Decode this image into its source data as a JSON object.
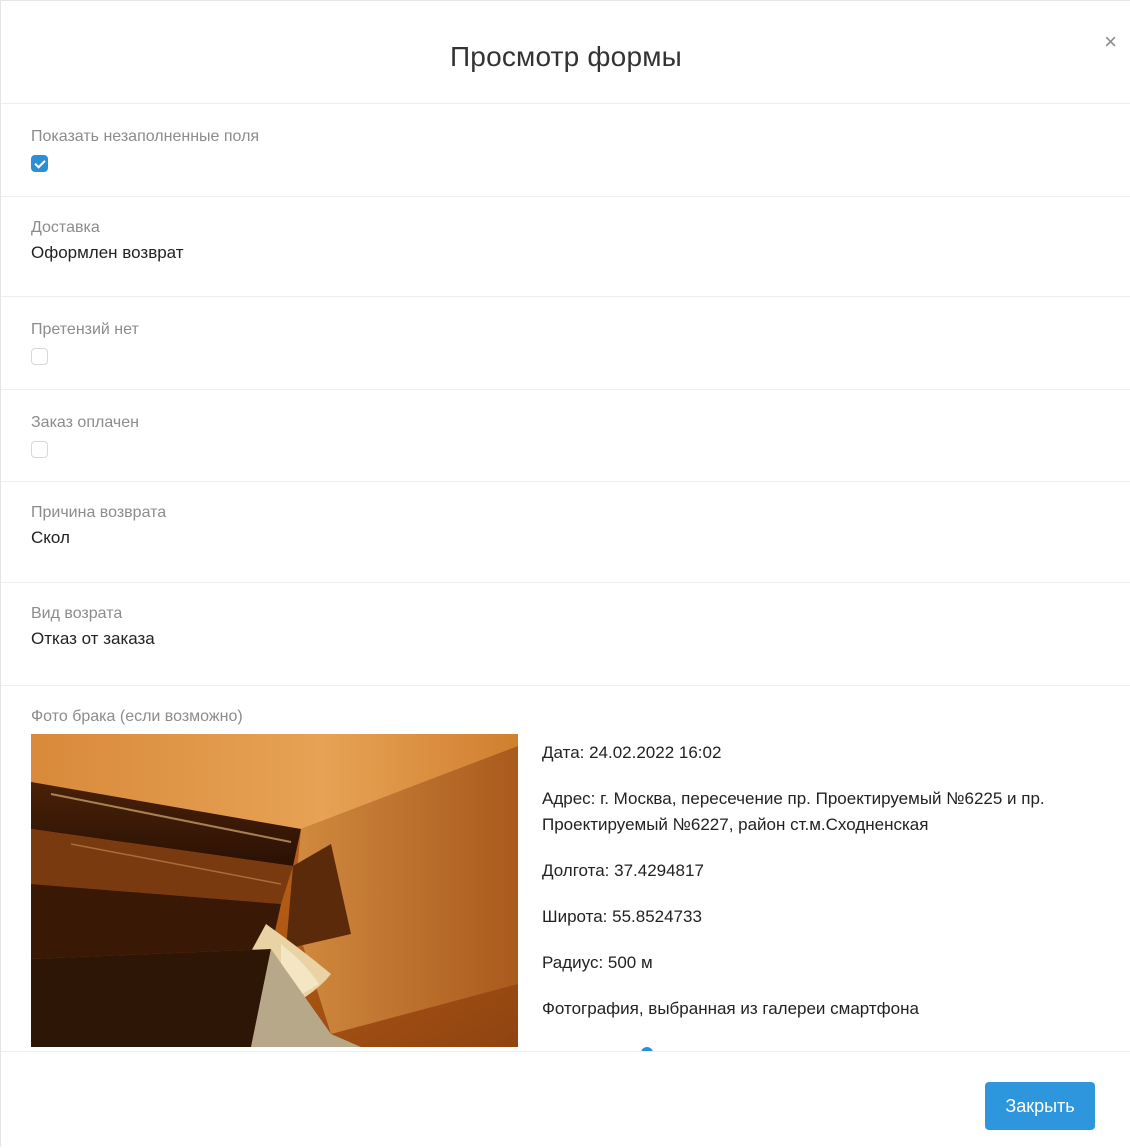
{
  "modal": {
    "title": "Просмотр формы",
    "close_icon": "×",
    "close_button_label": "Закрыть"
  },
  "fields": {
    "show_empty": {
      "label": "Показать незаполненные поля",
      "checked": true
    },
    "delivery": {
      "label": "Доставка",
      "value": "Оформлен возврат"
    },
    "no_claims": {
      "label": "Претензий нет",
      "checked": false
    },
    "order_paid": {
      "label": "Заказ оплачен",
      "checked": false
    },
    "return_reason": {
      "label": "Причина возврата",
      "value": "Скол"
    },
    "return_type": {
      "label": "Вид возрата",
      "value": "Отказ от заказа"
    },
    "defect_photo": {
      "label": "Фото брака (если возможно)",
      "date": "Дата: 24.02.2022 16:02",
      "address": "Адрес: г. Москва, пересечение пр. Проектируемый №6225 и пр. Проектируемый №6227, район ст.м.Сходненская",
      "longitude": "Долгота: 37.4294817",
      "latitude": "Широта: 55.8524733",
      "radius": "Радиус: 500 м",
      "source": "Фотография, выбранная из галереи смартфона"
    }
  },
  "colors": {
    "accent": "#2d96dd",
    "label": "#8c8c8c",
    "divider": "#eeeeee"
  }
}
